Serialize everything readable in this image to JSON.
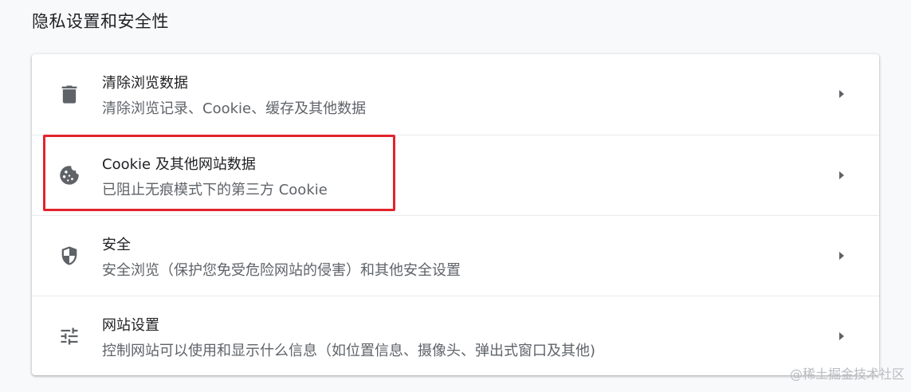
{
  "section": {
    "title": "隐私设置和安全性"
  },
  "rows": [
    {
      "icon": "trash-icon",
      "title": "清除浏览数据",
      "subtitle": "清除浏览记录、Cookie、缓存及其他数据"
    },
    {
      "icon": "cookie-icon",
      "title": "Cookie 及其他网站数据",
      "subtitle": "已阻止无痕模式下的第三方 Cookie"
    },
    {
      "icon": "shield-icon",
      "title": "安全",
      "subtitle": "安全浏览（保护您免受危险网站的侵害）和其他安全设置"
    },
    {
      "icon": "tune-icon",
      "title": "网站设置",
      "subtitle": "控制网站可以使用和显示什么信息（如位置信息、摄像头、弹出式窗口及其他)"
    }
  ],
  "watermark": "@稀土掘金技术社区",
  "colors": {
    "highlight": "#e3232b",
    "icon": "#5f6368",
    "title_text": "#202124",
    "subtitle_text": "#5f6368"
  }
}
